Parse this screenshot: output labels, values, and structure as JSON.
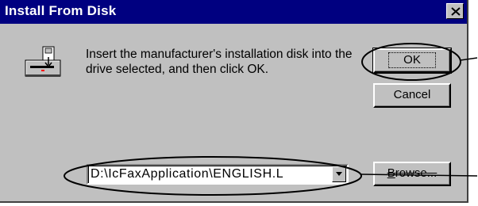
{
  "window": {
    "title": "Install From Disk",
    "close_icon": "close-icon"
  },
  "body": {
    "icon": "install-disk-icon",
    "message": "Insert the manufacturer's installation disk into the drive selected, and then click OK."
  },
  "buttons": {
    "ok_label": "OK",
    "cancel_label": "Cancel",
    "browse_label_underlined": "B",
    "browse_label_rest": "rowse..."
  },
  "path_combo": {
    "value": "D:\\IcFaxApplication\\ENGLISH.L",
    "arrow_icon": "chevron-down-icon"
  },
  "colors": {
    "titlebar": "#000080",
    "face": "#c0c0c0",
    "title_text": "#ffffff"
  }
}
